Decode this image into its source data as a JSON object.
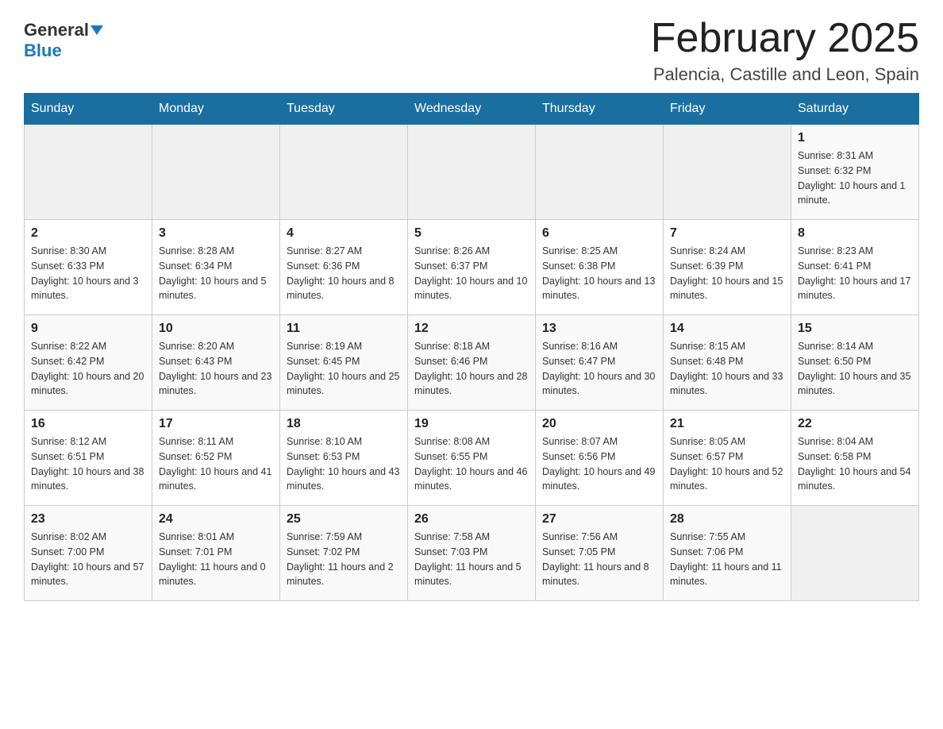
{
  "logo": {
    "general": "General",
    "blue": "Blue"
  },
  "title": "February 2025",
  "subtitle": "Palencia, Castille and Leon, Spain",
  "days_of_week": [
    "Sunday",
    "Monday",
    "Tuesday",
    "Wednesday",
    "Thursday",
    "Friday",
    "Saturday"
  ],
  "weeks": [
    [
      {
        "day": "",
        "info": ""
      },
      {
        "day": "",
        "info": ""
      },
      {
        "day": "",
        "info": ""
      },
      {
        "day": "",
        "info": ""
      },
      {
        "day": "",
        "info": ""
      },
      {
        "day": "",
        "info": ""
      },
      {
        "day": "1",
        "info": "Sunrise: 8:31 AM\nSunset: 6:32 PM\nDaylight: 10 hours and 1 minute."
      }
    ],
    [
      {
        "day": "2",
        "info": "Sunrise: 8:30 AM\nSunset: 6:33 PM\nDaylight: 10 hours and 3 minutes."
      },
      {
        "day": "3",
        "info": "Sunrise: 8:28 AM\nSunset: 6:34 PM\nDaylight: 10 hours and 5 minutes."
      },
      {
        "day": "4",
        "info": "Sunrise: 8:27 AM\nSunset: 6:36 PM\nDaylight: 10 hours and 8 minutes."
      },
      {
        "day": "5",
        "info": "Sunrise: 8:26 AM\nSunset: 6:37 PM\nDaylight: 10 hours and 10 minutes."
      },
      {
        "day": "6",
        "info": "Sunrise: 8:25 AM\nSunset: 6:38 PM\nDaylight: 10 hours and 13 minutes."
      },
      {
        "day": "7",
        "info": "Sunrise: 8:24 AM\nSunset: 6:39 PM\nDaylight: 10 hours and 15 minutes."
      },
      {
        "day": "8",
        "info": "Sunrise: 8:23 AM\nSunset: 6:41 PM\nDaylight: 10 hours and 17 minutes."
      }
    ],
    [
      {
        "day": "9",
        "info": "Sunrise: 8:22 AM\nSunset: 6:42 PM\nDaylight: 10 hours and 20 minutes."
      },
      {
        "day": "10",
        "info": "Sunrise: 8:20 AM\nSunset: 6:43 PM\nDaylight: 10 hours and 23 minutes."
      },
      {
        "day": "11",
        "info": "Sunrise: 8:19 AM\nSunset: 6:45 PM\nDaylight: 10 hours and 25 minutes."
      },
      {
        "day": "12",
        "info": "Sunrise: 8:18 AM\nSunset: 6:46 PM\nDaylight: 10 hours and 28 minutes."
      },
      {
        "day": "13",
        "info": "Sunrise: 8:16 AM\nSunset: 6:47 PM\nDaylight: 10 hours and 30 minutes."
      },
      {
        "day": "14",
        "info": "Sunrise: 8:15 AM\nSunset: 6:48 PM\nDaylight: 10 hours and 33 minutes."
      },
      {
        "day": "15",
        "info": "Sunrise: 8:14 AM\nSunset: 6:50 PM\nDaylight: 10 hours and 35 minutes."
      }
    ],
    [
      {
        "day": "16",
        "info": "Sunrise: 8:12 AM\nSunset: 6:51 PM\nDaylight: 10 hours and 38 minutes."
      },
      {
        "day": "17",
        "info": "Sunrise: 8:11 AM\nSunset: 6:52 PM\nDaylight: 10 hours and 41 minutes."
      },
      {
        "day": "18",
        "info": "Sunrise: 8:10 AM\nSunset: 6:53 PM\nDaylight: 10 hours and 43 minutes."
      },
      {
        "day": "19",
        "info": "Sunrise: 8:08 AM\nSunset: 6:55 PM\nDaylight: 10 hours and 46 minutes."
      },
      {
        "day": "20",
        "info": "Sunrise: 8:07 AM\nSunset: 6:56 PM\nDaylight: 10 hours and 49 minutes."
      },
      {
        "day": "21",
        "info": "Sunrise: 8:05 AM\nSunset: 6:57 PM\nDaylight: 10 hours and 52 minutes."
      },
      {
        "day": "22",
        "info": "Sunrise: 8:04 AM\nSunset: 6:58 PM\nDaylight: 10 hours and 54 minutes."
      }
    ],
    [
      {
        "day": "23",
        "info": "Sunrise: 8:02 AM\nSunset: 7:00 PM\nDaylight: 10 hours and 57 minutes."
      },
      {
        "day": "24",
        "info": "Sunrise: 8:01 AM\nSunset: 7:01 PM\nDaylight: 11 hours and 0 minutes."
      },
      {
        "day": "25",
        "info": "Sunrise: 7:59 AM\nSunset: 7:02 PM\nDaylight: 11 hours and 2 minutes."
      },
      {
        "day": "26",
        "info": "Sunrise: 7:58 AM\nSunset: 7:03 PM\nDaylight: 11 hours and 5 minutes."
      },
      {
        "day": "27",
        "info": "Sunrise: 7:56 AM\nSunset: 7:05 PM\nDaylight: 11 hours and 8 minutes."
      },
      {
        "day": "28",
        "info": "Sunrise: 7:55 AM\nSunset: 7:06 PM\nDaylight: 11 hours and 11 minutes."
      },
      {
        "day": "",
        "info": ""
      }
    ]
  ],
  "accent_color": "#1a6fa0"
}
